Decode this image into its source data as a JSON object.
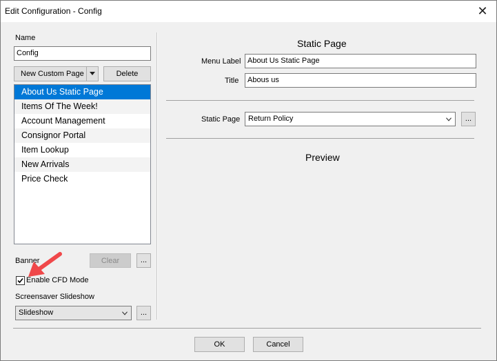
{
  "window": {
    "title": "Edit Configuration - Config",
    "close_glyph": "✕"
  },
  "left": {
    "name_label": "Name",
    "name_value": "Config",
    "new_page_button": "New Custom Page",
    "delete_button": "Delete",
    "pages": [
      "About Us Static Page",
      "Items Of The Week!",
      "Account Management",
      "Consignor Portal",
      "Item Lookup",
      "New Arrivals",
      "Price Check"
    ],
    "selected_page_index": 0,
    "banner_label": "Banner",
    "clear_button": "Clear",
    "ellipsis": "...",
    "cfd_checkbox_label": "Enable CFD Mode",
    "cfd_checked": true,
    "screensaver_label": "Screensaver Slideshow",
    "screensaver_value": "Slideshow"
  },
  "right": {
    "section_title": "Static Page",
    "menu_label_label": "Menu Label",
    "menu_label_value": "About Us Static Page",
    "title_label": "Title",
    "title_value": "Abous us",
    "static_page_label": "Static Page",
    "static_page_value": "Return Policy",
    "ellipsis": "...",
    "preview_title": "Preview"
  },
  "footer": {
    "ok_button": "OK",
    "cancel_button": "Cancel"
  },
  "annotation": {
    "arrow_color": "#f0484a",
    "icon": "red-arrow-icon"
  }
}
